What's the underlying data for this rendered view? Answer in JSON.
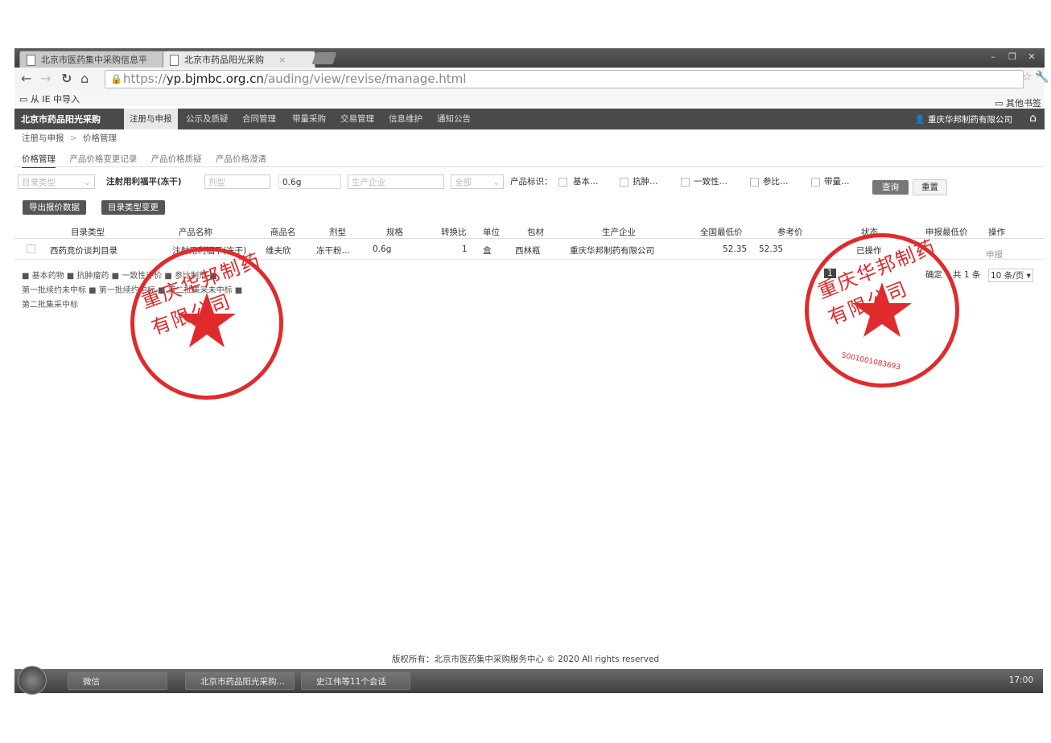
{
  "browser": {
    "tabs": [
      {
        "title": "北京市医药集中采购信息平"
      },
      {
        "title": "北京市药品阳光采购"
      }
    ],
    "url_prefix": "https://",
    "url_domain": "yp.bjmbc.org.cn",
    "url_path": "/auding/view/revise/manage.html",
    "bookmark_left": "从 IE 中导入",
    "bookmark_right": "其他书签"
  },
  "app": {
    "brand": "北京市药品阳光采购",
    "nav": [
      "注册与申报",
      "公示及质疑",
      "合同管理",
      "带量采购",
      "交易管理",
      "信息维护",
      "通知公告"
    ],
    "active_nav": 0,
    "company": "重庆华邦制药有限公司"
  },
  "breadcrumb": {
    "root": "注册与申报",
    "sep": ">",
    "current": "价格管理"
  },
  "subtabs": [
    "价格管理",
    "产品价格变更记录",
    "产品价格质疑",
    "产品价格澄清"
  ],
  "filters": {
    "catalog_type": "目录类型",
    "product_name": "注射用利福平(冻干)",
    "dosage_form": "剂型",
    "spec": "0.6g",
    "manufacturer": "生产企业",
    "status": "全部",
    "marker_label": "产品标识：",
    "markers": [
      "基本…",
      "抗肿…",
      "一致性…",
      "参比…",
      "带量…"
    ],
    "query_btn": "查询",
    "reset_btn": "重置"
  },
  "actions": {
    "export": "导出报价数据",
    "change_type": "目录类型变更"
  },
  "table": {
    "headers": [
      "目录类型",
      "产品名称",
      "商品名",
      "剂型",
      "规格",
      "转换比",
      "单位",
      "包材",
      "生产企业",
      "全国最低价",
      "参考价",
      "状态",
      "申报最低价",
      "操作"
    ],
    "rows": [
      [
        "西药竞价谈判目录",
        "注射用利福平(冻干)",
        "维夫欣",
        "冻干粉…",
        "0.6g",
        "1",
        "盒",
        "西林瓶",
        "重庆华邦制药有限公司",
        "52.35",
        "52.35",
        "已操作",
        "",
        "申报"
      ]
    ]
  },
  "legend": {
    "line1": "■ 基本药物  ■ 抗肿瘤药  ■ 一致性评价  ■ 参比制剂  ■",
    "line2": "第一批续约未中标  ■ 第一批续约中标  ■ 第二批集采未中标  ■",
    "line3": "第二批集采中标"
  },
  "pager": {
    "page": "1",
    "confirm": "确定",
    "total": "共 1 条",
    "per_page": "10 条/页"
  },
  "footer": "版权所有：北京市医药集中采购服务中心 © 2020 All rights reserved",
  "taskbar": {
    "tasks": [
      "微信",
      "北京市药品阳光采购…",
      "史江伟等11个会话"
    ],
    "time": "17:00"
  },
  "seals": {
    "left_text": "重庆华邦制药有限公司",
    "right_text": "重庆华邦制药有限公司",
    "right_number": "5001001083693"
  },
  "colors": {
    "seal": "#e8282a",
    "appbar": "#4a4a4a"
  }
}
